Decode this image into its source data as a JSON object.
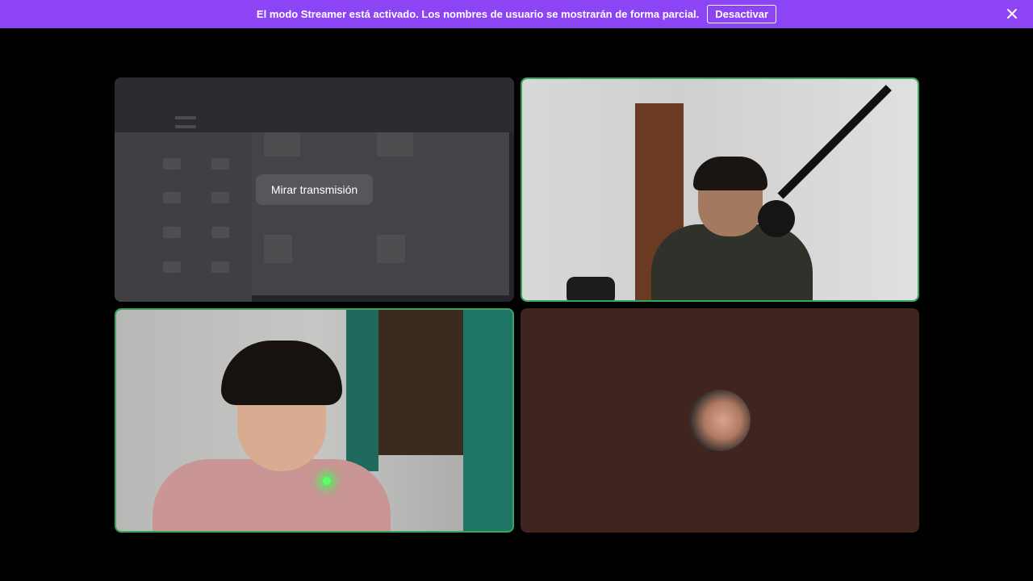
{
  "banner": {
    "message": "El modo Streamer está activado. Los nombres de usuario se mostrarán de forma parcial.",
    "button_label": "Desactivar",
    "close_icon": "close-icon",
    "background_color": "#8c44f4"
  },
  "grid": {
    "stream_tile": {
      "watch_button_label": "Mirar transmisión"
    },
    "speaking_border_color": "#3ba55d",
    "avatar_tile_color": "#3f2420"
  }
}
